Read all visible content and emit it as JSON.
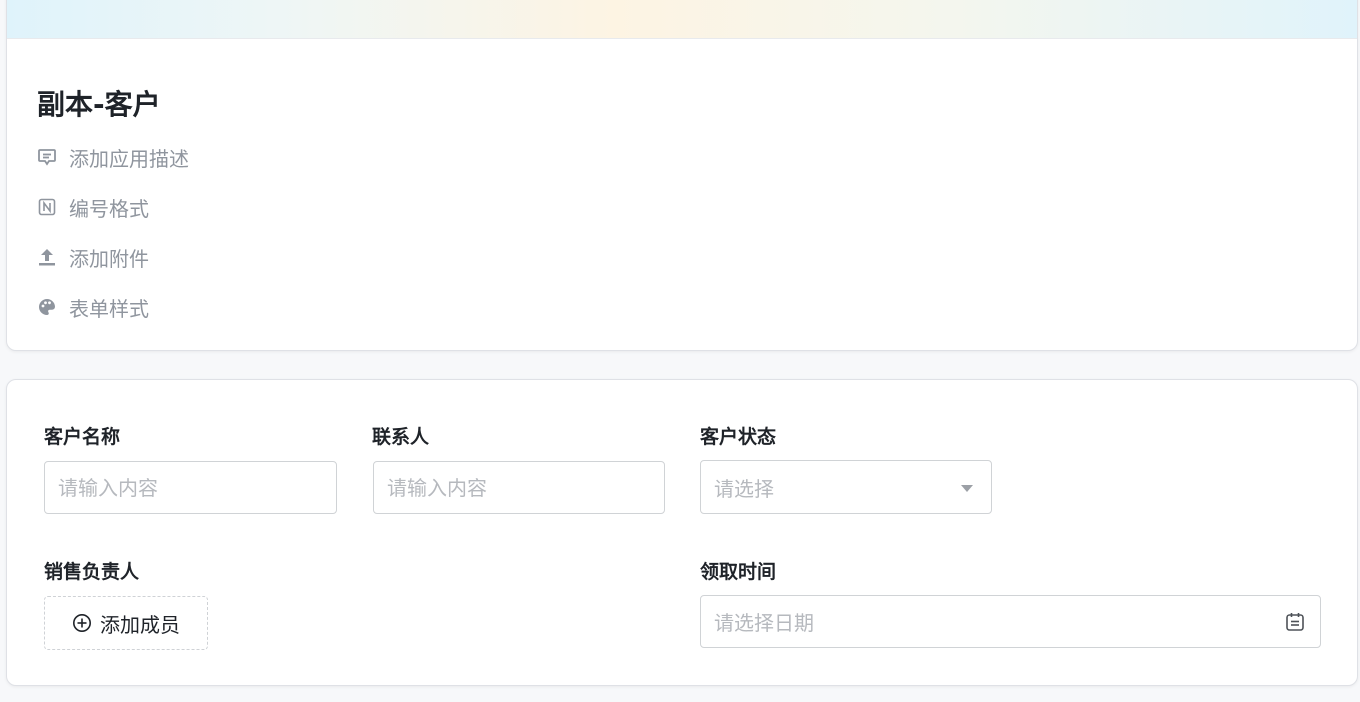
{
  "app": {
    "title": "副本-客户"
  },
  "options": [
    {
      "icon": "comment-icon",
      "label": "添加应用描述"
    },
    {
      "icon": "number-format-icon",
      "label": "编号格式"
    },
    {
      "icon": "upload-icon",
      "label": "添加附件"
    },
    {
      "icon": "palette-icon",
      "label": "表单样式"
    }
  ],
  "form": {
    "customer_name": {
      "label": "客户名称",
      "placeholder": "请输入内容"
    },
    "contact": {
      "label": "联系人",
      "placeholder": "请输入内容"
    },
    "status": {
      "label": "客户状态",
      "placeholder": "请选择"
    },
    "sales_owner": {
      "label": "销售负责人",
      "button": "添加成员"
    },
    "claim_time": {
      "label": "领取时间",
      "placeholder": "请选择日期"
    }
  }
}
